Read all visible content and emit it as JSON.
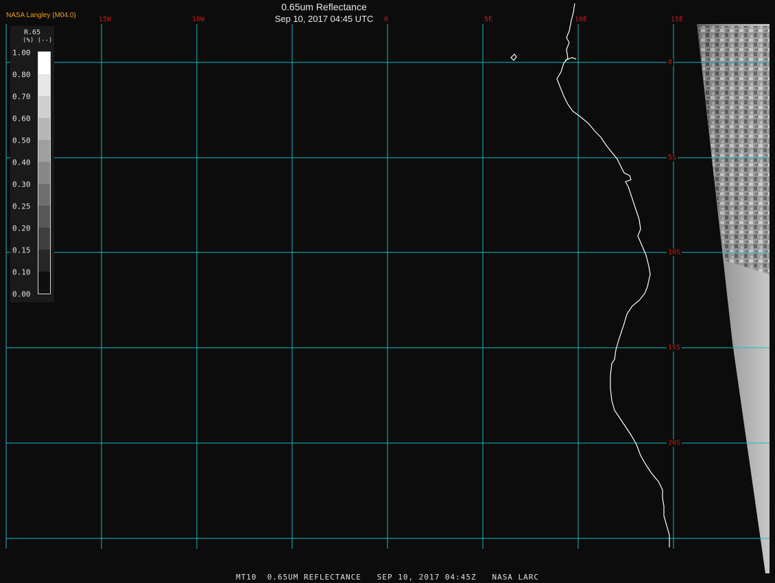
{
  "header": {
    "source": "NASA Langley (M04.0)",
    "title": "0.65um Reflectance",
    "datetime": "Sep 10, 2017 04:45 UTC"
  },
  "longitude_labels": [
    "15W",
    "10W",
    "0",
    "5E",
    "10E",
    "15E"
  ],
  "latitude_labels": [
    "0",
    "5S",
    "10S",
    "15S",
    "20S"
  ],
  "legend": {
    "variable": "R.65",
    "unit": "(%) (--)",
    "ticks": [
      "1.00",
      "0.80",
      "0.70",
      "0.60",
      "0.50",
      "0.40",
      "0.30",
      "0.25",
      "0.20",
      "0.15",
      "0.10",
      "0.00"
    ]
  },
  "footer": {
    "caption": "MT10  0.65UM REFLECTANCE   SEP 10, 2017 04:45Z   NASA LARC"
  },
  "colors": {
    "grid": "#19b9c6",
    "lat_lon_labels": "#d01818",
    "coastline": "#ffffff",
    "source_label": "#f0a020"
  }
}
